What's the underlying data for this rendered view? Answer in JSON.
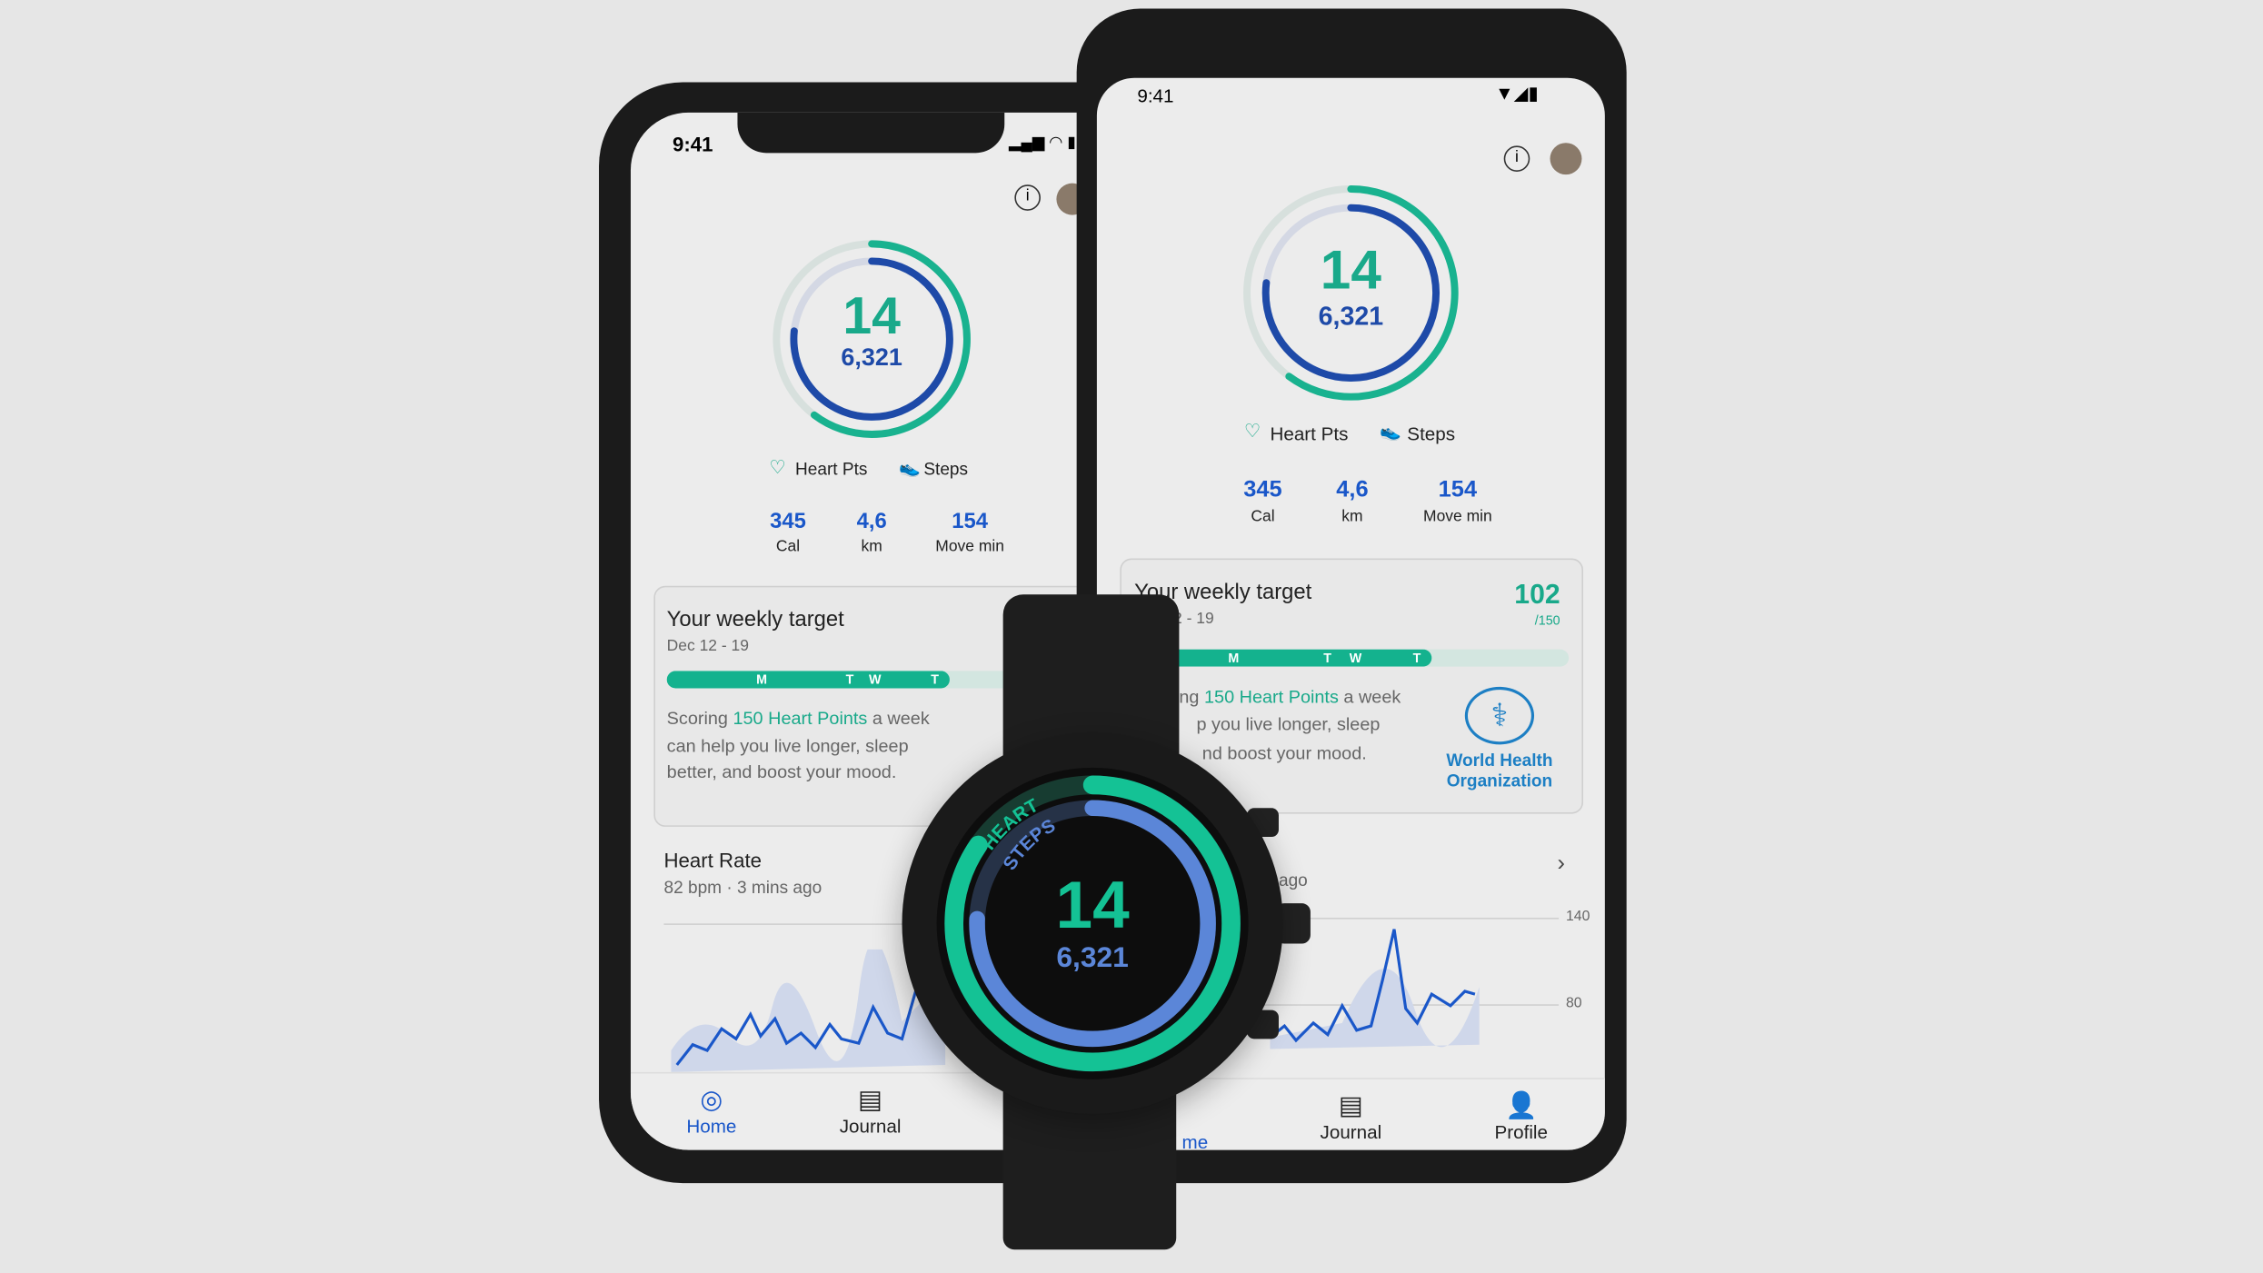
{
  "status": {
    "time": "9:41"
  },
  "summary": {
    "heart_pts": "14",
    "steps": "6,321",
    "legend_heart": "Heart Pts",
    "legend_steps": "Steps",
    "stats": [
      {
        "value": "345",
        "label": "Cal"
      },
      {
        "value": "4,6",
        "label": "km"
      },
      {
        "value": "154",
        "label": "Move min"
      }
    ]
  },
  "weekly": {
    "title": "Your weekly target",
    "dates": "Dec 12 - 19",
    "dates_partial": "2 - 19",
    "score": "102",
    "goal": "/150",
    "progress": 0.68,
    "days": [
      "M",
      "T",
      "W",
      "T"
    ],
    "text_pre": "Scoring ",
    "text_highlight": "150 Heart Points",
    "text_post": " a week",
    "line2": "can help you live longer, sleep",
    "line3": "better, and boost your mood.",
    "partial_line1": "ng ",
    "partial_line2": "p you live longer, sleep",
    "partial_line3": "nd boost your mood.",
    "who_logo": "World Health Organization",
    "who_line1": "World Health",
    "who_line2": "Organization"
  },
  "heart_rate": {
    "title": "Heart Rate",
    "subtitle": "82 bpm · 3 mins ago",
    "partial": "ago",
    "axis": [
      "140",
      "80"
    ]
  },
  "nav": {
    "home": "Home",
    "home_partial": "me",
    "journal": "Journal",
    "profile": "Profile"
  },
  "watch": {
    "heart_label": "HEART",
    "steps_label": "STEPS",
    "heart_pts": "14",
    "steps": "6,321"
  },
  "colors": {
    "teal": "#19a98a",
    "blue": "#1a57c9",
    "watch_green": "#14c295",
    "watch_blue": "#5b86d8"
  }
}
